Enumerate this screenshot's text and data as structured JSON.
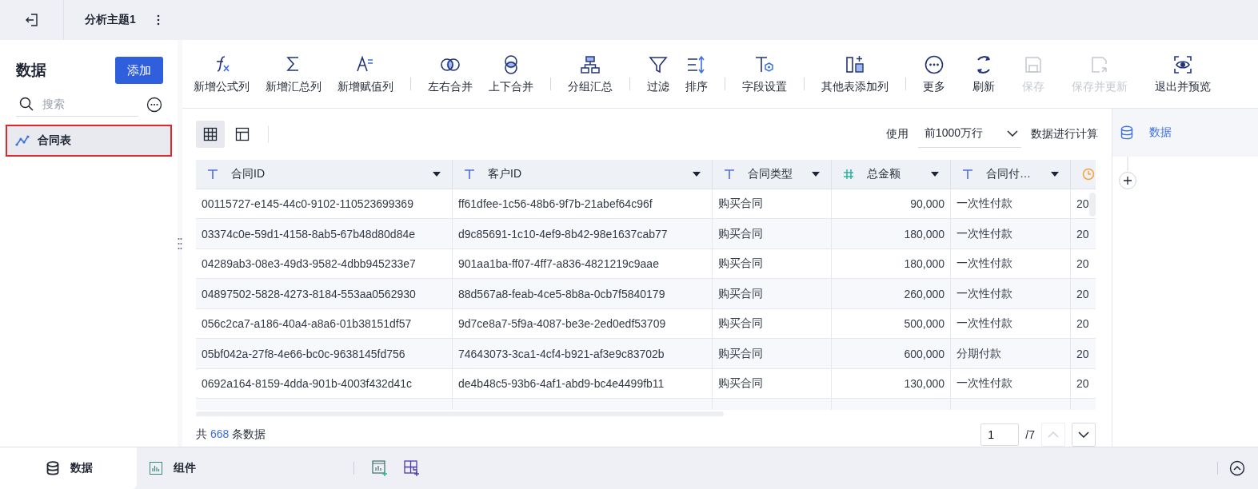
{
  "top_bar": {
    "title": "分析主题1"
  },
  "data_panel": {
    "heading": "数据",
    "add_button": "添加",
    "search": {
      "placeholder": "搜索"
    },
    "tables": [
      {
        "label": "合同表",
        "selected": true
      }
    ]
  },
  "toolbar": {
    "groups": [
      [
        {
          "label": "新增公式列",
          "disabled": false
        },
        {
          "label": "新增汇总列",
          "disabled": false
        },
        {
          "label": "新增赋值列",
          "disabled": false
        }
      ],
      [
        {
          "label": "左右合并",
          "disabled": false
        },
        {
          "label": "上下合并",
          "disabled": false
        }
      ],
      [
        {
          "label": "分组汇总",
          "disabled": false
        }
      ],
      [
        {
          "label": "过滤",
          "disabled": false
        },
        {
          "label": "排序",
          "disabled": false
        }
      ],
      [
        {
          "label": "字段设置",
          "disabled": false
        }
      ],
      [
        {
          "label": "其他表添加列",
          "disabled": false
        }
      ],
      [
        {
          "label": "更多",
          "disabled": false
        },
        {
          "label": "刷新",
          "disabled": false
        },
        {
          "label": "保存",
          "disabled": true
        },
        {
          "label": "保存并更新",
          "disabled": true
        },
        {
          "label": "退出并预览",
          "disabled": false
        }
      ]
    ]
  },
  "view_toggles": [
    {
      "selected": true
    },
    {
      "selected": false
    }
  ],
  "row_limit": {
    "prefix": "使用",
    "value": "前1000万行",
    "suffix": "数据进行计算"
  },
  "table": {
    "columns": [
      {
        "label": "合同ID",
        "kind": "text"
      },
      {
        "label": "客户ID",
        "kind": "text"
      },
      {
        "label": "合同类型",
        "kind": "text"
      },
      {
        "label": "总金额",
        "kind": "number"
      },
      {
        "label": "合同付…",
        "kind": "text"
      },
      {
        "kind": "date"
      }
    ],
    "rows": [
      [
        "00115727-e145-44c0-9102-110523699369",
        "ff61dfee-1c56-48b6-9f7b-21abef64c96f",
        "购买合同",
        "90,000",
        "一次性付款",
        "20"
      ],
      [
        "03374c0e-59d1-4158-8ab5-67b48d80d84e",
        "d9c85691-1c10-4ef9-8b42-98e1637cab77",
        "购买合同",
        "180,000",
        "一次性付款",
        "20"
      ],
      [
        "04289ab3-08e3-49d3-9582-4dbb945233e7",
        "901aa1ba-ff07-4ff7-a836-4821219c9aae",
        "购买合同",
        "180,000",
        "一次性付款",
        "20"
      ],
      [
        "04897502-5828-4273-8184-553aa0562930",
        "88d567a8-feab-4ce5-8b8a-0cb7f5840179",
        "购买合同",
        "260,000",
        "一次性付款",
        "20"
      ],
      [
        "056c2ca7-a186-40a4-a8a6-01b38151df57",
        "9d7ce8a7-5f9a-4087-be3e-2ed0edf53709",
        "购买合同",
        "500,000",
        "一次性付款",
        "20"
      ],
      [
        "05bf042a-27f8-4e66-bc0c-9638145fd756",
        "74643073-3ca1-4cf4-b921-af3e9c83702b",
        "购买合同",
        "600,000",
        "分期付款",
        "20"
      ],
      [
        "0692a164-8159-4dda-901b-4003f432d41c",
        "de4b48c5-93b6-4af1-abd9-bc4e4499fb11",
        "购买合同",
        "130,000",
        "一次性付款",
        "20"
      ]
    ]
  },
  "footer": {
    "prefix": "共",
    "count": "668",
    "suffix": "条数据"
  },
  "pagination": {
    "page": "1",
    "total": "/7",
    "prev_disabled": true,
    "next_disabled": false
  },
  "flow_panel": {
    "nodes": [
      {
        "label": "数据",
        "selected": true
      }
    ]
  },
  "bottom_tabs": [
    {
      "label": "数据",
      "selected": true
    },
    {
      "label": "组件",
      "selected": false
    }
  ]
}
